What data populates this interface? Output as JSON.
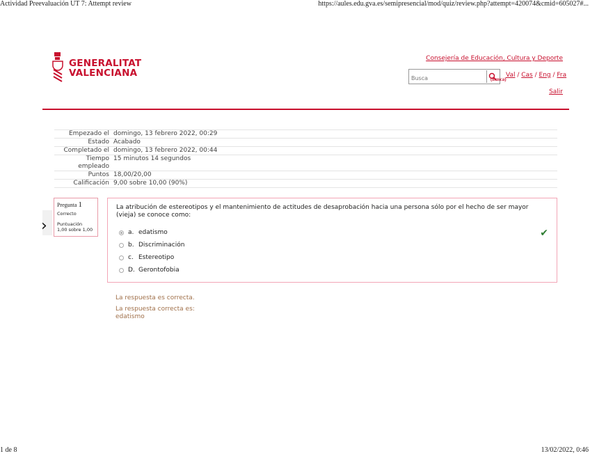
{
  "print": {
    "title": "Actividad Preevaluación UT 7: Attempt review",
    "url": "https://aules.edu.gva.es/semipresencial/mod/quiz/review.php?attempt=420074&cmid=605027#...",
    "page": "1 de 8",
    "datetime": "13/02/2022, 0:46"
  },
  "header": {
    "logo_line1": "GENERALITAT",
    "logo_line2": "VALENCIANA",
    "department_link": "Consejería de Educación, Cultura y Deporte",
    "search_placeholder": "Busca",
    "search_button_label": "(Busca)",
    "languages": [
      "Val",
      "Cas",
      "Eng",
      "Fra"
    ],
    "logout": "Salir",
    "accent_color": "#c8102e"
  },
  "summary": [
    {
      "label": "Empezado el",
      "value": "domingo, 13 febrero 2022, 00:29"
    },
    {
      "label": "Estado",
      "value": "Acabado"
    },
    {
      "label": "Completado el",
      "value": "domingo, 13 febrero 2022, 00:44"
    },
    {
      "label": "Tiempo empleado",
      "value": "15 minutos 14 segundos"
    },
    {
      "label": "Puntos",
      "value": "18,00/20,00"
    },
    {
      "label": "Calificación",
      "value": "9,00 sobre 10,00 (90%)"
    }
  ],
  "question": {
    "label": "Pregunta",
    "number": "1",
    "state": "Correcto",
    "score_label": "Puntuación",
    "score": "1,00 sobre 1,00",
    "text": "La atribución de estereotipos y el mantenimiento de actitudes de desaprobación hacia una persona sólo por el hecho de ser mayor (vieja) se conoce como:",
    "answers": [
      {
        "letter": "a.",
        "text": "edatismo",
        "selected": true
      },
      {
        "letter": "b.",
        "text": "Discriminación",
        "selected": false
      },
      {
        "letter": "c.",
        "text": "Estereotipo",
        "selected": false
      },
      {
        "letter": "D.",
        "text": "Gerontofobia",
        "selected": false
      }
    ],
    "correct_icon": "checkmark-icon"
  },
  "feedback": {
    "line1": "La respuesta es correcta.",
    "line2": "La respuesta correcta es:",
    "line3": "edatismo"
  }
}
